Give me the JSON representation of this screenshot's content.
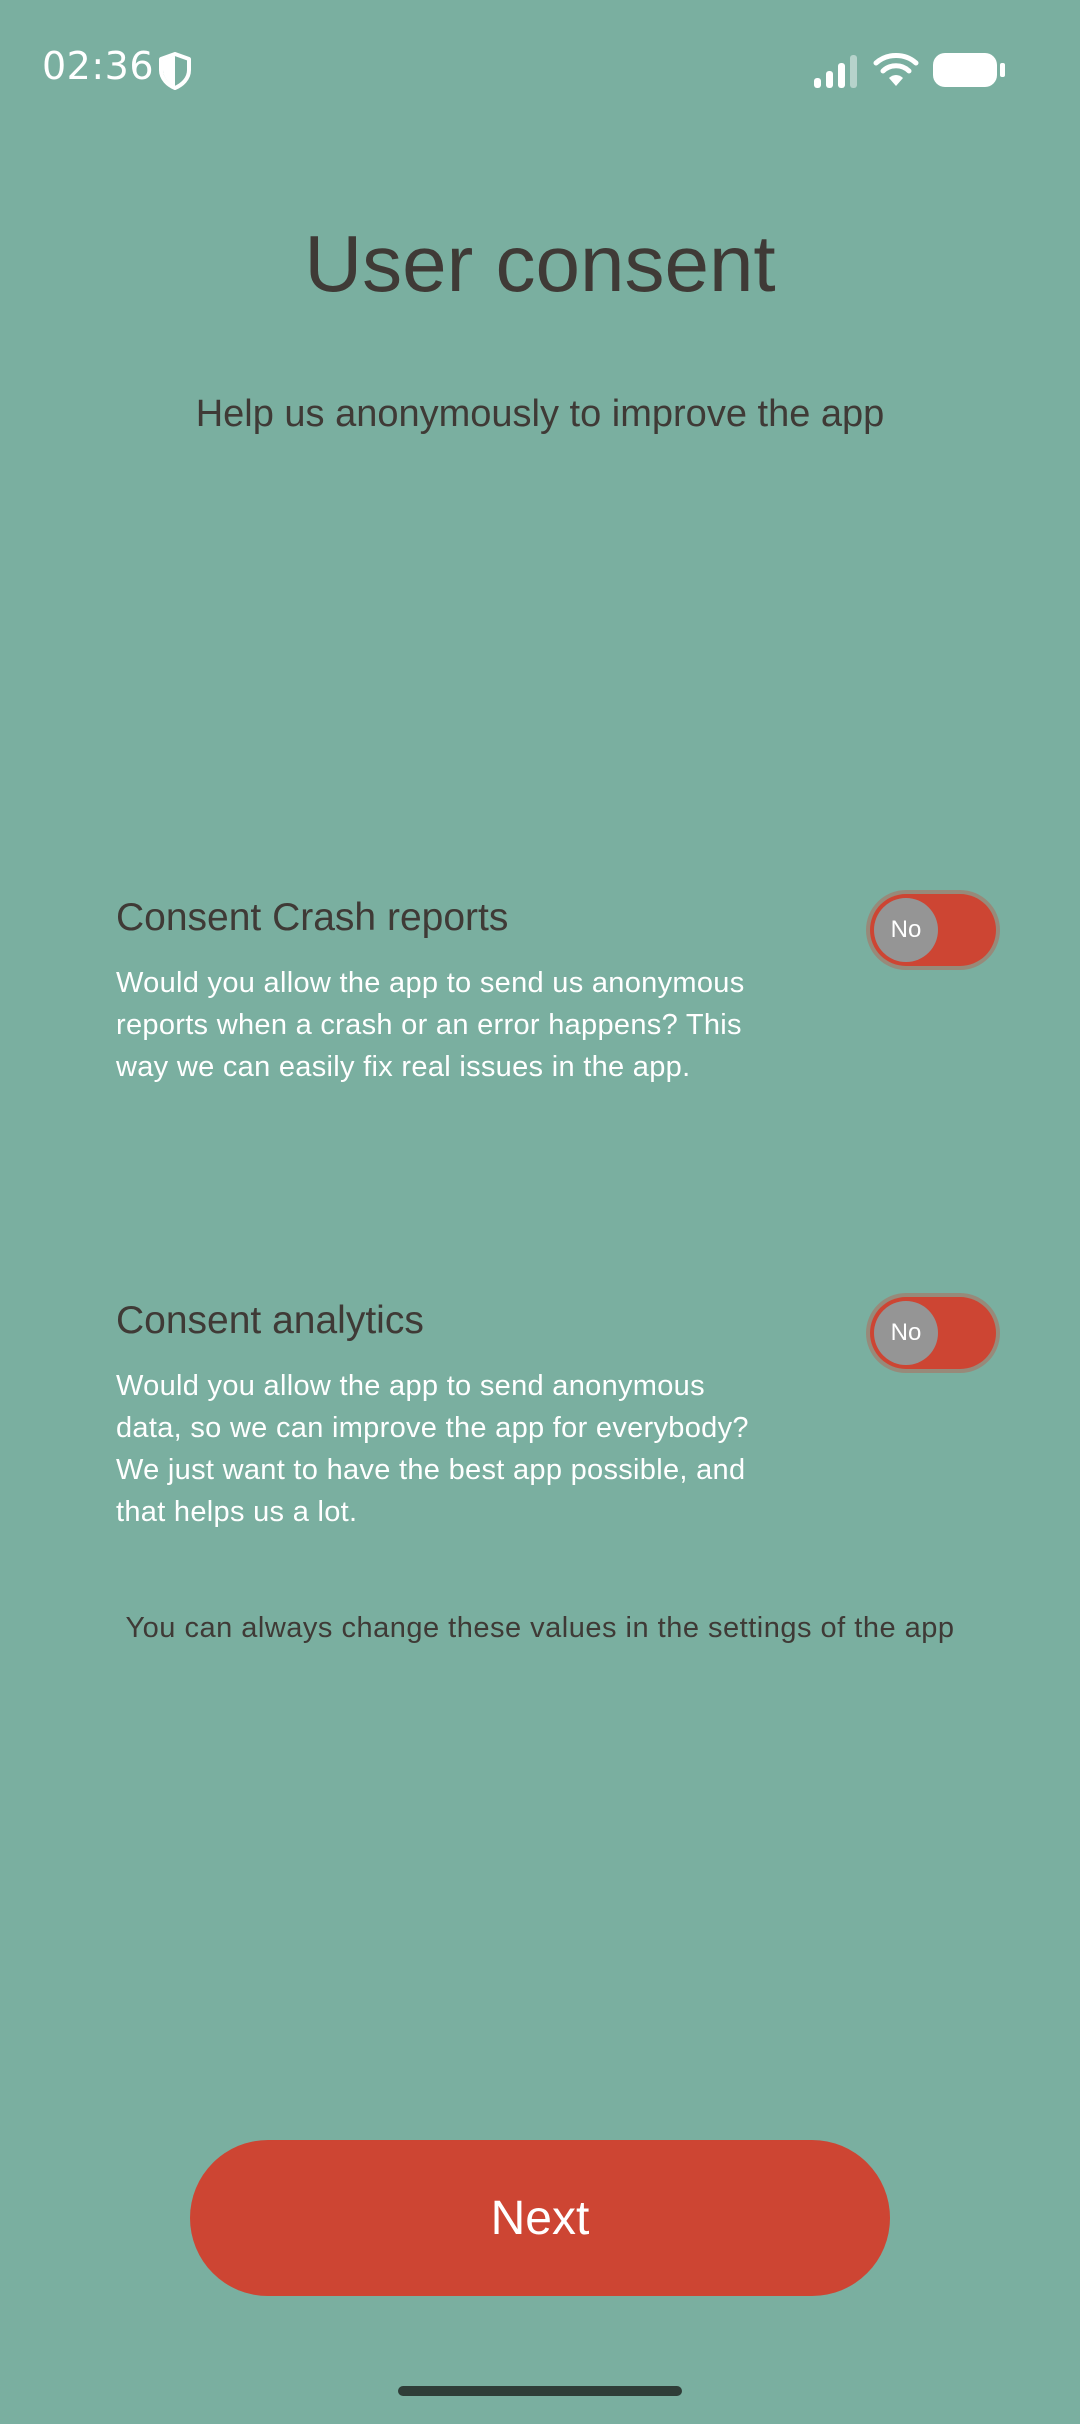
{
  "status_bar": {
    "time": "02:36",
    "icons": [
      "shield-icon",
      "signal-icon",
      "wifi-icon",
      "battery-icon"
    ]
  },
  "header": {
    "title": "User consent",
    "subtitle": "Help us anonymously to improve the app"
  },
  "consents": [
    {
      "title": "Consent Crash reports",
      "description": "Would you allow the app to send us anonymous reports when a crash or an error happens? This way we can easily fix real issues in the app.",
      "toggle_label": "No"
    },
    {
      "title": "Consent analytics",
      "description": "Would you allow the app to send anonymous data, so we can improve the app for everybody? We just want to have the best app possible, and that helps us a lot.",
      "toggle_label": "No"
    }
  ],
  "footnote": "You can always change these values in the settings of the app",
  "next_button": {
    "label": "Next"
  },
  "colors": {
    "background": "#7aafa0",
    "accent": "#cd4533",
    "text_dark": "#3f3a36",
    "text_light": "#ffffff",
    "toggle_knob": "#959595"
  }
}
